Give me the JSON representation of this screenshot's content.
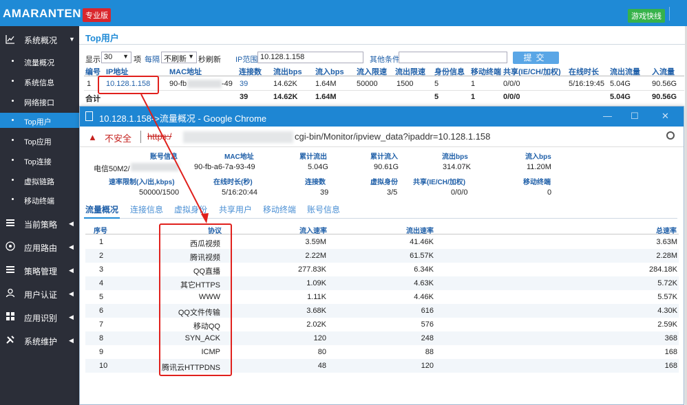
{
  "header": {
    "brand": "AMARANTEN",
    "edition": "专业版",
    "fast_button": "游戏快线"
  },
  "sidebar": {
    "group_monitor": "系统概况",
    "items": [
      "流量概况",
      "系统信息",
      "网络接口",
      "Top用户",
      "Top应用",
      "Top连接",
      "虚拟链路",
      "移动终端"
    ],
    "groups": [
      "当前策略",
      "应用路由",
      "策略管理",
      "用户认证",
      "应用识别",
      "系统维护"
    ]
  },
  "main": {
    "title": "Top用户",
    "toolbar": {
      "show_label": "显示",
      "show_value": "30",
      "items_label": "项",
      "every_label": "每隔",
      "refresh_value": "不刷新",
      "refresh_suffix": "秒刷新",
      "ip_range_label": "IP范围",
      "ip_range_value": "10.128.1.158",
      "other_label": "其他条件",
      "other_value": "",
      "submit": "提交"
    },
    "columns": [
      "编号",
      "IP地址",
      "MAC地址",
      "连接数",
      "流出bps",
      "流入bps",
      "流入限速",
      "流出限速",
      "身份信息",
      "移动终端",
      "共享(IE/CH/加权)",
      "在线时长",
      "流出流量",
      "入流量"
    ],
    "row": {
      "no": "1",
      "ip": "10.128.1.158",
      "mac_prefix": "90-fb",
      "mac_suffix": "-49",
      "conn": "39",
      "out_bps": "14.62K",
      "in_bps": "1.64M",
      "in_limit": "50000",
      "out_limit": "1500",
      "identity": "5",
      "mobile": "1",
      "share": "0/0/0",
      "online": "5/16:19:45",
      "out_traffic": "5.04G",
      "in_traffic": "90.56G"
    },
    "total": {
      "label": "合计",
      "conn": "39",
      "out_bps": "14.62K",
      "in_bps": "1.64M",
      "identity": "5",
      "mobile": "1",
      "share": "0/0/0",
      "out_traffic": "5.04G",
      "in_traffic": "90.56G"
    }
  },
  "popup": {
    "window_title": "10.128.1.158->流量概况 - Google Chrome",
    "insecure_label": "不安全",
    "url_scheme": "https:/",
    "url_path": "cgi-bin/Monitor/ipview_data?ipaddr=10.128.1.158",
    "info": {
      "account_label": "账号信息",
      "account_value": "电信50M2/",
      "mac_label": "MAC地址",
      "mac_value": "90-fb-a6-7a-93-49",
      "total_out_label": "累计流出",
      "total_out_value": "5.04G",
      "total_in_label": "累计流入",
      "total_in_value": "90.61G",
      "out_bps_label": "流出bps",
      "out_bps_value": "314.07K",
      "in_bps_label": "流入bps",
      "in_bps_value": "11.20M",
      "limit_label": "速率限制(入/出,kbps)",
      "limit_value": "50000/1500",
      "online_label": "在线时长(秒)",
      "online_value": "5/16:20:44",
      "conn_label": "连接数",
      "conn_value": "39",
      "virtual_label": "虚拟身份",
      "virtual_value": "3/5",
      "share_label": "共享(IE/CH/加权)",
      "share_value": "0/0/0",
      "mobile_label": "移动终端",
      "mobile_value": "0"
    },
    "tabs": [
      "流量概况",
      "连接信息",
      "虚拟身份",
      "共享用户",
      "移动终端",
      "账号信息"
    ],
    "table_columns": [
      "序号",
      "协议",
      "流入速率",
      "流出速率",
      "总速率"
    ],
    "rows": [
      {
        "no": "1",
        "proto": "西瓜视频",
        "in": "3.59M",
        "out": "41.46K",
        "total": "3.63M"
      },
      {
        "no": "2",
        "proto": "腾讯视频",
        "in": "2.22M",
        "out": "61.57K",
        "total": "2.28M"
      },
      {
        "no": "3",
        "proto": "QQ直播",
        "in": "277.83K",
        "out": "6.34K",
        "total": "284.18K"
      },
      {
        "no": "4",
        "proto": "其它HTTPS",
        "in": "1.09K",
        "out": "4.63K",
        "total": "5.72K"
      },
      {
        "no": "5",
        "proto": "WWW",
        "in": "1.11K",
        "out": "4.46K",
        "total": "5.57K"
      },
      {
        "no": "6",
        "proto": "QQ文件传输",
        "in": "3.68K",
        "out": "616",
        "total": "4.30K"
      },
      {
        "no": "7",
        "proto": "移动QQ",
        "in": "2.02K",
        "out": "576",
        "total": "2.59K"
      },
      {
        "no": "8",
        "proto": "SYN_ACK",
        "in": "120",
        "out": "248",
        "total": "368"
      },
      {
        "no": "9",
        "proto": "ICMP",
        "in": "80",
        "out": "88",
        "total": "168"
      },
      {
        "no": "10",
        "proto": "腾讯云HTTPDNS",
        "in": "48",
        "out": "120",
        "total": "168"
      }
    ]
  },
  "colors": {
    "accent": "#1f8ad6",
    "sidebar": "#2b2e38",
    "highlight": "#e0201c"
  }
}
